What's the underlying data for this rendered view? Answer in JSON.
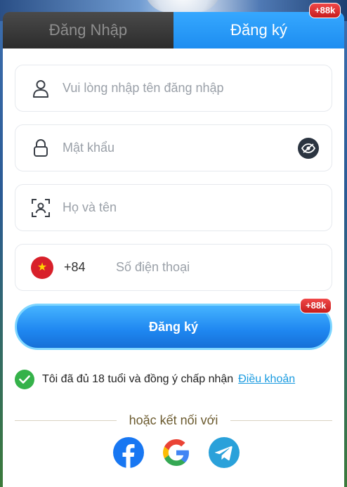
{
  "tabs": {
    "login": "Đăng Nhập",
    "register": "Đăng ký"
  },
  "badges": {
    "tab": "+88k",
    "button": "+88k"
  },
  "form": {
    "username_placeholder": "Vui lòng nhập tên đăng nhập",
    "password_placeholder": "Mật khẩu",
    "fullname_placeholder": "Họ và tên",
    "phone_code": "+84",
    "phone_placeholder": "Số điện thoại"
  },
  "submit_label": "Đăng ký",
  "terms": {
    "text": "Tôi đã đủ 18 tuổi và đồng ý chấp nhận",
    "link": "Điều khoản"
  },
  "divider_text": "hoặc kết nối với",
  "colors": {
    "accent": "#1e86f0",
    "badge": "#d62828",
    "check": "#35b24a"
  },
  "social": [
    "facebook-icon",
    "google-icon",
    "telegram-icon"
  ]
}
